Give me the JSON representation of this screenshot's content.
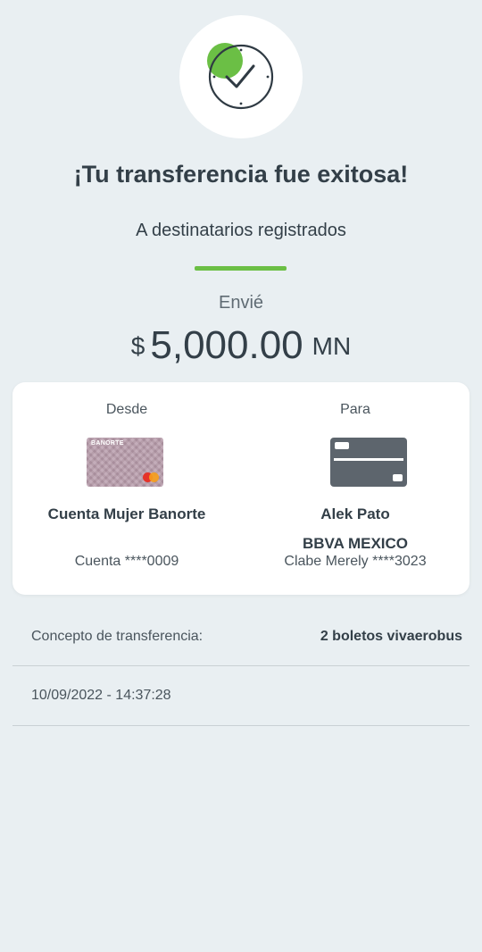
{
  "header": {
    "icon": "check-clock-icon",
    "title": "¡Tu transferencia fue exitosa!",
    "subtitle": "A destinatarios registrados"
  },
  "amount": {
    "label": "Envié",
    "currency_symbol": "$",
    "value": "5,000.00",
    "unit": "MN"
  },
  "transfer": {
    "from": {
      "label": "Desde",
      "card_icon": "banorte-card-icon",
      "card_brand": "BANORTE",
      "name": "Cuenta Mujer Banorte",
      "account": "Cuenta ****0009"
    },
    "to": {
      "label": "Para",
      "card_icon": "credit-card-icon",
      "name": "Alek Pato",
      "bank": "BBVA MEXICO",
      "account": "Clabe Merely ****3023"
    }
  },
  "details": {
    "concept_label": "Concepto de transferencia:",
    "concept_value": "2 boletos vivaerobus",
    "datetime": "10/09/2022 - 14:37:28"
  },
  "colors": {
    "background": "#e9eff2",
    "accent_green": "#6bbf45",
    "text_dark": "#333f48",
    "dest_card": "#5d656d",
    "source_card": "#b69aa9"
  }
}
